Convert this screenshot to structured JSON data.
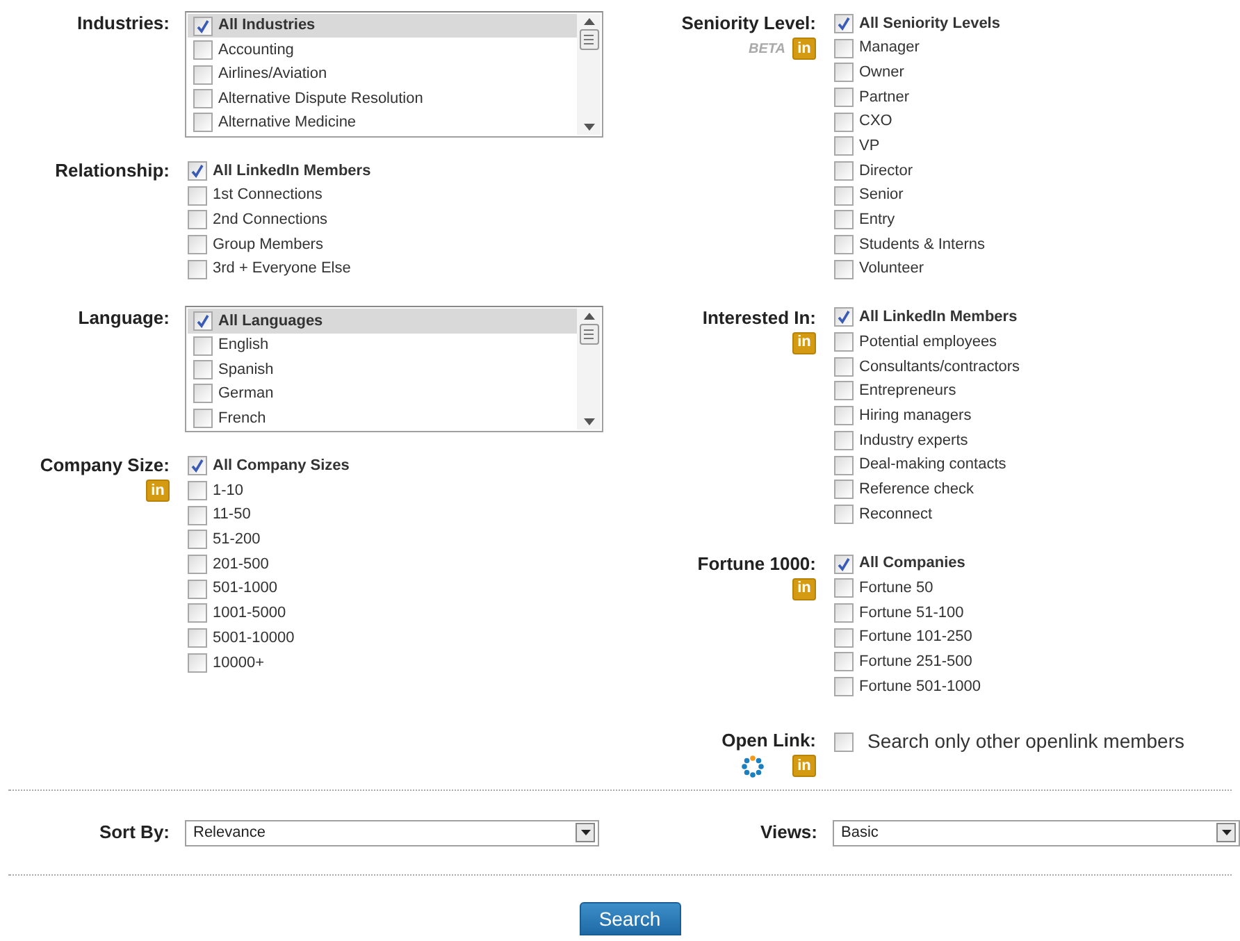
{
  "left": [
    {
      "label": "Industries:",
      "kind": "listbox",
      "options": [
        {
          "text": "All Industries",
          "checked": true,
          "selected": true
        },
        {
          "text": "Accounting",
          "checked": false,
          "selected": false
        },
        {
          "text": "Airlines/Aviation",
          "checked": false,
          "selected": false
        },
        {
          "text": "Alternative Dispute Resolution",
          "checked": false,
          "selected": false
        },
        {
          "text": "Alternative Medicine",
          "checked": false,
          "selected": false
        }
      ]
    },
    {
      "label": "Relationship:",
      "kind": "checklist",
      "options": [
        {
          "text": "All LinkedIn Members",
          "checked": true
        },
        {
          "text": "1st Connections",
          "checked": false
        },
        {
          "text": "2nd Connections",
          "checked": false
        },
        {
          "text": "Group Members",
          "checked": false
        },
        {
          "text": "3rd + Everyone Else",
          "checked": false
        }
      ]
    },
    {
      "label": "Language:",
      "kind": "listbox",
      "options": [
        {
          "text": "All Languages",
          "checked": true,
          "selected": true
        },
        {
          "text": "English",
          "checked": false,
          "selected": false
        },
        {
          "text": "Spanish",
          "checked": false,
          "selected": false
        },
        {
          "text": "German",
          "checked": false,
          "selected": false
        },
        {
          "text": "French",
          "checked": false,
          "selected": false
        }
      ]
    },
    {
      "label": "Company Size:",
      "kind": "checklist",
      "badges": [
        {
          "kind": "linkedin",
          "text": "in"
        }
      ],
      "options": [
        {
          "text": "All Company Sizes",
          "checked": true
        },
        {
          "text": "1-10",
          "checked": false
        },
        {
          "text": "11-50",
          "checked": false
        },
        {
          "text": "51-200",
          "checked": false
        },
        {
          "text": "201-500",
          "checked": false
        },
        {
          "text": "501-1000",
          "checked": false
        },
        {
          "text": "1001-5000",
          "checked": false
        },
        {
          "text": "5001-10000",
          "checked": false
        },
        {
          "text": "10000+",
          "checked": false
        }
      ]
    }
  ],
  "right": [
    {
      "label": "Seniority Level:",
      "kind": "checklist",
      "badges": [
        {
          "kind": "beta",
          "text": "BETA"
        },
        {
          "kind": "linkedin",
          "text": "in"
        }
      ],
      "options": [
        {
          "text": "All Seniority Levels",
          "checked": true
        },
        {
          "text": "Manager",
          "checked": false
        },
        {
          "text": "Owner",
          "checked": false
        },
        {
          "text": "Partner",
          "checked": false
        },
        {
          "text": "CXO",
          "checked": false
        },
        {
          "text": "VP",
          "checked": false
        },
        {
          "text": "Director",
          "checked": false
        },
        {
          "text": "Senior",
          "checked": false
        },
        {
          "text": "Entry",
          "checked": false
        },
        {
          "text": "Students & Interns",
          "checked": false
        },
        {
          "text": "Volunteer",
          "checked": false
        }
      ]
    },
    {
      "label": "Interested In:",
      "kind": "checklist",
      "badges": [
        {
          "kind": "linkedin",
          "text": "in"
        }
      ],
      "options": [
        {
          "text": "All LinkedIn Members",
          "checked": true
        },
        {
          "text": "Potential employees",
          "checked": false
        },
        {
          "text": "Consultants/contractors",
          "checked": false
        },
        {
          "text": "Entrepreneurs",
          "checked": false
        },
        {
          "text": "Hiring managers",
          "checked": false
        },
        {
          "text": "Industry experts",
          "checked": false
        },
        {
          "text": "Deal-making contacts",
          "checked": false
        },
        {
          "text": "Reference check",
          "checked": false
        },
        {
          "text": "Reconnect",
          "checked": false
        }
      ]
    },
    {
      "label": "Fortune 1000:",
      "kind": "checklist",
      "badges": [
        {
          "kind": "linkedin",
          "text": "in"
        }
      ],
      "options": [
        {
          "text": "All Companies",
          "checked": true
        },
        {
          "text": "Fortune 50",
          "checked": false
        },
        {
          "text": "Fortune 51-100",
          "checked": false
        },
        {
          "text": "Fortune 101-250",
          "checked": false
        },
        {
          "text": "Fortune 251-500",
          "checked": false
        },
        {
          "text": "Fortune 501-1000",
          "checked": false
        }
      ]
    },
    {
      "label": "Open Link:",
      "kind": "single",
      "badges": [
        {
          "kind": "openlink"
        },
        {
          "kind": "linkedin",
          "text": "in"
        }
      ],
      "options": [
        {
          "text": "Search only other openlink members",
          "checked": false
        }
      ]
    }
  ],
  "sort_by": {
    "label": "Sort By:",
    "value": "Relevance"
  },
  "views": {
    "label": "Views:",
    "value": "Basic"
  },
  "search_button": "Search"
}
